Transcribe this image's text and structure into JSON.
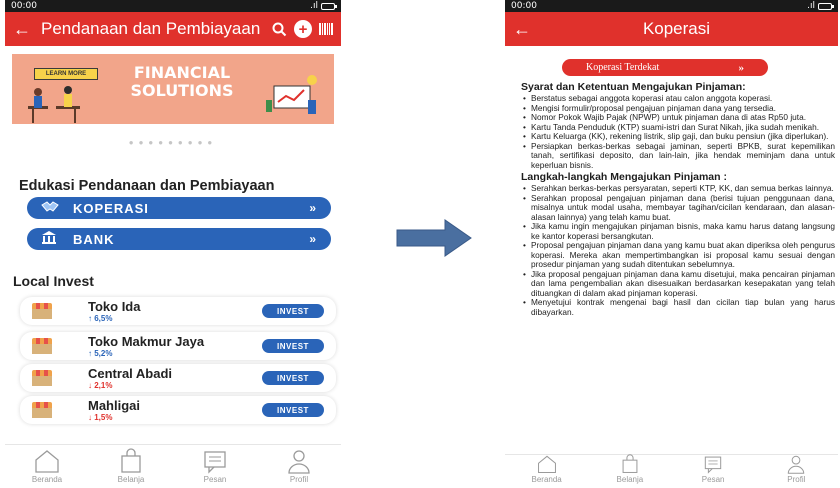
{
  "left_phone": {
    "status_time": "00:00",
    "app_title": "Pendanaan dan Pembiayaan",
    "banner": {
      "learn_more": "LEARN MORE",
      "title": "FINANCIAL SOLUTIONS"
    },
    "edu_title": "Edukasi Pendanaan dan Pembiayaan",
    "menu": [
      {
        "label": "KOPERASI",
        "icon": "handshake-icon"
      },
      {
        "label": "BANK",
        "icon": "bank-icon"
      }
    ],
    "local_invest_title": "Local Invest",
    "invest_label": "INVEST",
    "items": [
      {
        "name": "Toko Ida",
        "change": "6,5%",
        "trend": "up"
      },
      {
        "name": "Toko Makmur Jaya",
        "change": "5,2%",
        "trend": "up"
      },
      {
        "name": "Central Abadi",
        "change": "2,1%",
        "trend": "down"
      },
      {
        "name": "Mahligai",
        "change": "1,5%",
        "trend": "down"
      }
    ],
    "tabs": [
      "Beranda",
      "Belanja",
      "Pesan",
      "Profil"
    ]
  },
  "right_phone": {
    "status_time": "00:00",
    "app_title": "Koperasi",
    "nearby_button": "Koperasi Terdekat",
    "section1_title": "Syarat dan Ketentuan Mengajukan Pinjaman:",
    "section1_items": [
      "Berstatus sebagai anggota koperasi atau calon anggota koperasi.",
      "Mengisi formulir/proposal pengajuan pinjaman dana yang tersedia.",
      "Nomor Pokok Wajib Pajak (NPWP) untuk pinjaman dana di atas Rp50 juta.",
      "Kartu Tanda Penduduk (KTP) suami-istri dan Surat Nikah, jika sudah menikah.",
      "Kartu Keluarga (KK), rekening listrik, slip gaji, dan buku pensiun (jika diperlukan).",
      "Persiapkan berkas-berkas sebagai jaminan, seperti BPKB, surat kepemilikan tanah, sertifikasi deposito, dan lain-lain, jika hendak meminjam dana untuk keperluan bisnis."
    ],
    "section2_title": "Langkah-langkah Mengajukan Pinjaman :",
    "section2_items": [
      "Serahkan berkas-berkas persyaratan, seperti KTP, KK, dan semua berkas lainnya.",
      "Serahkan proposal pengajuan pinjaman dana (berisi tujuan penggunaan dana, misalnya untuk modal usaha, membayar tagihan/cicilan kendaraan, dan alasan-alasan lainnya) yang telah kamu buat.",
      "Jika kamu ingin mengajukan pinjaman bisnis, maka kamu harus datang langsung ke kantor koperasi bersangkutan.",
      "Proposal pengajuan pinjaman dana yang kamu buat akan diperiksa oleh pengurus koperasi. Mereka akan mempertimbangkan isi proposal kamu sesuai dengan prosedur pinjaman yang sudah ditentukan sebelumnya.",
      "Jika proposal pengajuan pinjaman dana kamu disetujui, maka pencairan pinjaman dan lama pengembalian akan disesuaikan berdasarkan kesepakatan yang telah dituangkan di dalam akad pinjaman koperasi.",
      "Menyetujui kontrak mengenai bagi hasil dan cicilan tiap bulan yang harus dibayarkan."
    ],
    "tabs": [
      "Beranda",
      "Belanja",
      "Pesan",
      "Profil"
    ]
  },
  "colors": {
    "primary_red": "#e0312c",
    "primary_blue": "#2a64b8",
    "arrow_blue": "#4a6fa0"
  }
}
